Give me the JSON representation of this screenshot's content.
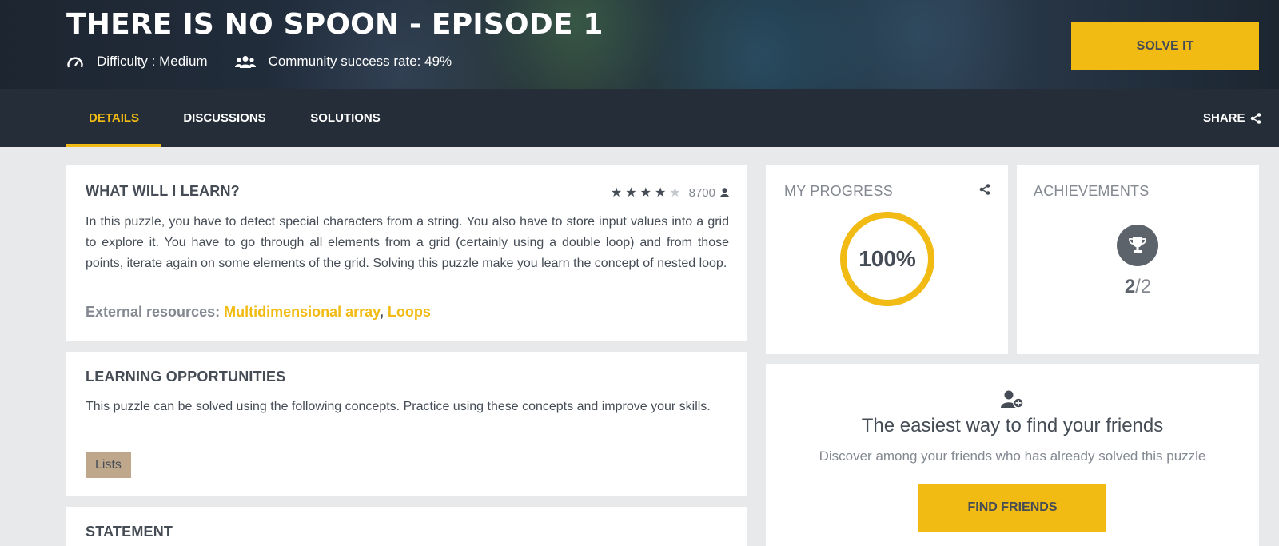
{
  "puzzle": {
    "title": "THERE IS NO SPOON - EPISODE 1",
    "difficulty": "Difficulty : Medium",
    "success_rate": "Community success rate: 49%",
    "solve_label": "SOLVE IT"
  },
  "tabs": [
    {
      "label": "DETAILS",
      "active": true
    },
    {
      "label": "DISCUSSIONS",
      "active": false
    },
    {
      "label": "SOLUTIONS",
      "active": false
    }
  ],
  "share_label": "SHARE",
  "learn": {
    "heading": "WHAT WILL I LEARN?",
    "rating_stars": 4,
    "rating_max": 5,
    "rating_count": "8700",
    "description": "In this puzzle, you have to detect special characters from a string. You also have to store input values into a grid to explore it. You have to go through all elements from a grid (certainly using a double loop) and from those points, iterate again on some elements of the grid. Solving this puzzle make you learn the concept of nested loop.",
    "resources_label": "External resources:",
    "resources": [
      "Multidimensional array",
      "Loops"
    ],
    "resources_separator": ","
  },
  "opportunities": {
    "heading": "LEARNING OPPORTUNITIES",
    "description": "This puzzle can be solved using the following concepts. Practice using these concepts and improve your skills.",
    "tags": [
      "Lists"
    ]
  },
  "statement": {
    "heading": "STATEMENT"
  },
  "progress": {
    "heading": "MY PROGRESS",
    "percent_label": "100%",
    "percent": 100
  },
  "achievements": {
    "heading": "ACHIEVEMENTS",
    "earned": "2",
    "total": "/2"
  },
  "friends": {
    "heading": "The easiest way to find your friends",
    "subtext": "Discover among your friends who has already solved this puzzle",
    "button_label": "FIND FRIENDS"
  },
  "colors": {
    "accent": "#f2bb13",
    "dark_bar": "#252e38",
    "text": "#454c55",
    "muted": "#838891",
    "tag_bg": "#bfa78b"
  },
  "icons": {
    "difficulty": "gauge-icon",
    "community": "users-icon",
    "share": "share-icon",
    "rating": "star-icon",
    "user": "user-icon",
    "trophy": "trophy-icon",
    "add_friend": "user-plus-icon"
  }
}
